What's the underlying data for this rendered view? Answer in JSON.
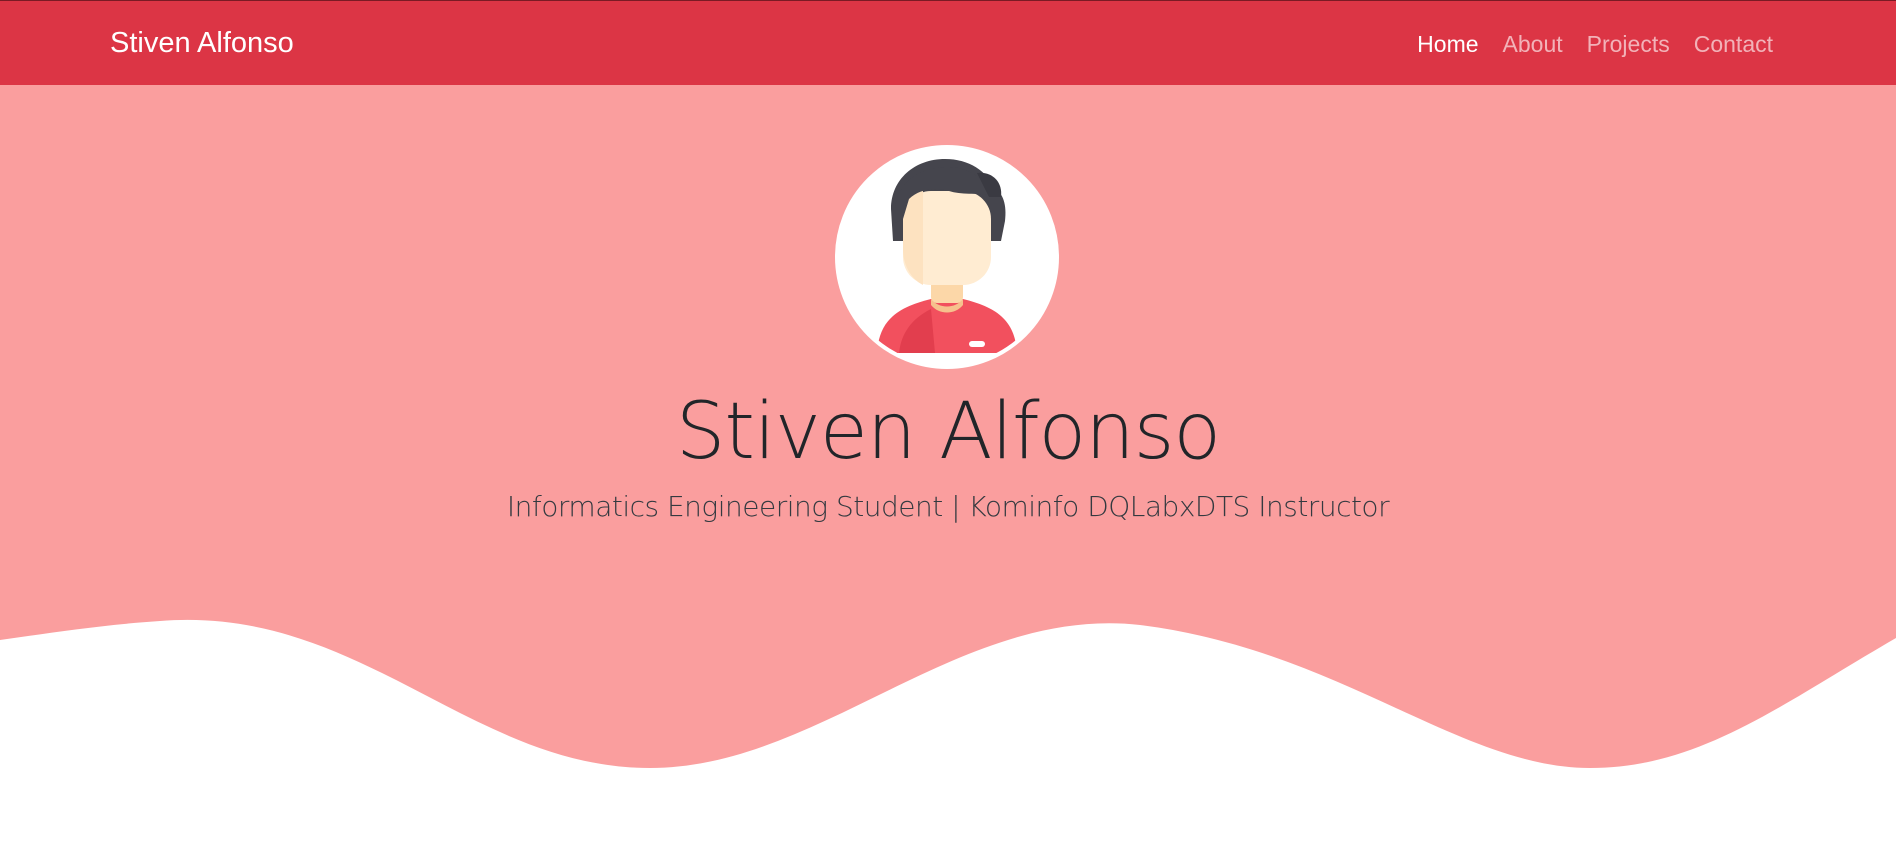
{
  "navbar": {
    "brand": "Stiven Alfonso",
    "links": [
      {
        "label": "Home",
        "active": true
      },
      {
        "label": "About",
        "active": false
      },
      {
        "label": "Projects",
        "active": false
      },
      {
        "label": "Contact",
        "active": false
      }
    ]
  },
  "hero": {
    "avatar_icon": "user-avatar-icon",
    "title": "Stiven Alfonso",
    "subtitle": "Informatics Engineering Student | Kominfo DQLabxDTS Instructor"
  },
  "colors": {
    "navbar_bg": "#dc3545",
    "hero_bg": "#fa9e9e",
    "page_bg": "#ffffff",
    "title_text": "#212529"
  }
}
